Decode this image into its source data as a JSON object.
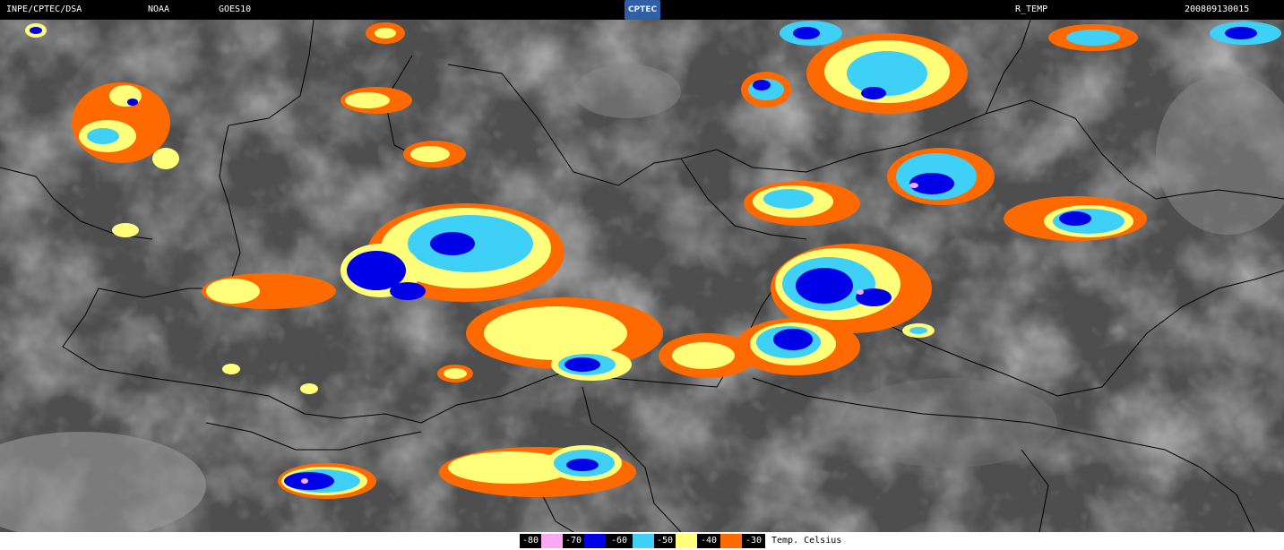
{
  "header": {
    "source": "INPE/CPTEC/DSA",
    "agency": "NOAA",
    "satellite": "GOES10",
    "logo_text": "CPTEC",
    "product": "R_TEMP",
    "timestamp": "200809130015"
  },
  "legend": {
    "unit_label": "Temp. Celsius",
    "classes": [
      {
        "label": "-80",
        "color": "#f9a8f3"
      },
      {
        "label": "-70",
        "color": "#0000e6"
      },
      {
        "label": "-60",
        "color": "#3fd0f7"
      },
      {
        "label": "-50",
        "color": "#ffff7a"
      },
      {
        "label": "-40",
        "color": "#ff6a00"
      },
      {
        "label": "-30",
        "color": ""
      }
    ]
  },
  "colors": {
    "background_ir": "#555555",
    "boundary": "#000000"
  }
}
